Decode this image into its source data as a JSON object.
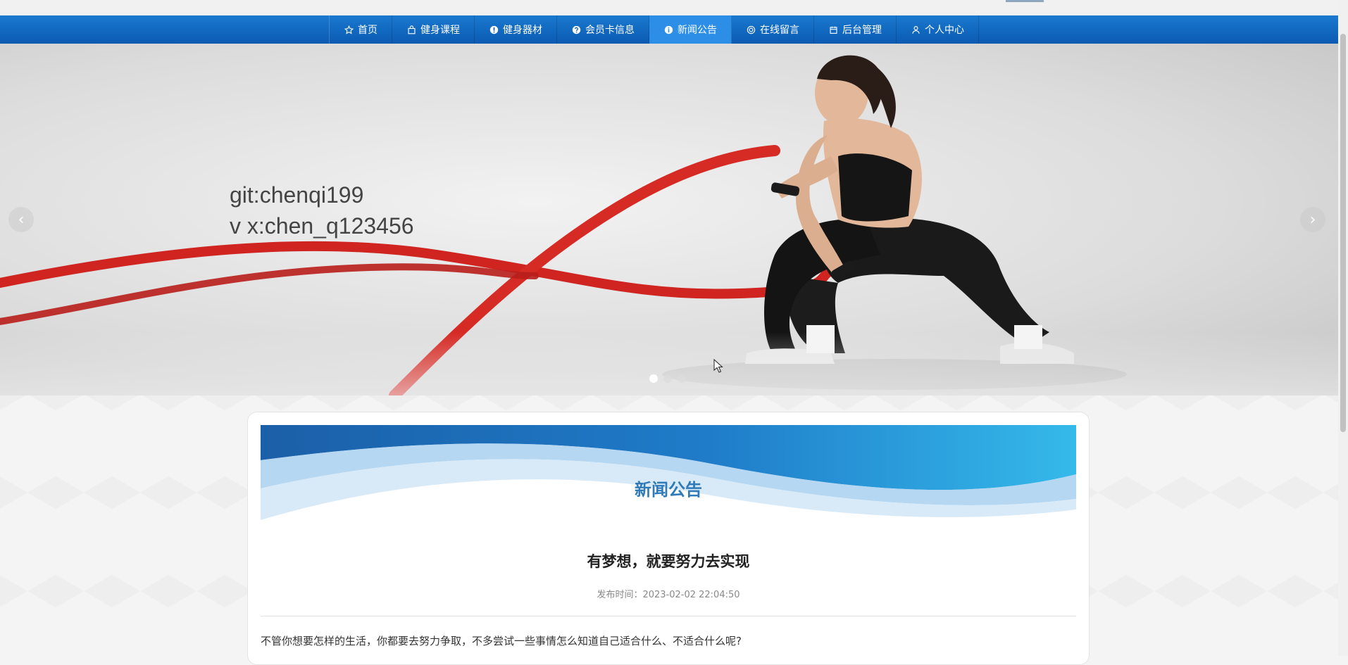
{
  "nav": {
    "items": [
      {
        "label": "首页",
        "icon": "star-icon"
      },
      {
        "label": "健身课程",
        "icon": "bag-icon"
      },
      {
        "label": "健身器材",
        "icon": "info-icon"
      },
      {
        "label": "会员卡信息",
        "icon": "question-icon"
      },
      {
        "label": "新闻公告",
        "icon": "info-circle-icon",
        "active": true
      },
      {
        "label": "在线留言",
        "icon": "target-icon"
      },
      {
        "label": "后台管理",
        "icon": "calendar-icon"
      },
      {
        "label": "个人中心",
        "icon": "user-icon"
      }
    ]
  },
  "hero": {
    "line1": "git:chenqi199",
    "line2": "v x:chen_q123456",
    "prev": "‹",
    "next": "›",
    "slide_count": 3,
    "active_slide": 1
  },
  "content": {
    "section_title": "新闻公告",
    "article_title": "有梦想，就要努力去实现",
    "publish_time": "发布时间：2023-02-02 22:04:50",
    "body": "不管你想要怎样的生活，你都要去努力争取，不多尝试一些事情怎么知道自己适合什么、不适合什么呢?"
  },
  "colors": {
    "nav_bg": "#0b5ab2",
    "nav_active": "#2c8ee6",
    "section_title": "#2f7ab8"
  }
}
